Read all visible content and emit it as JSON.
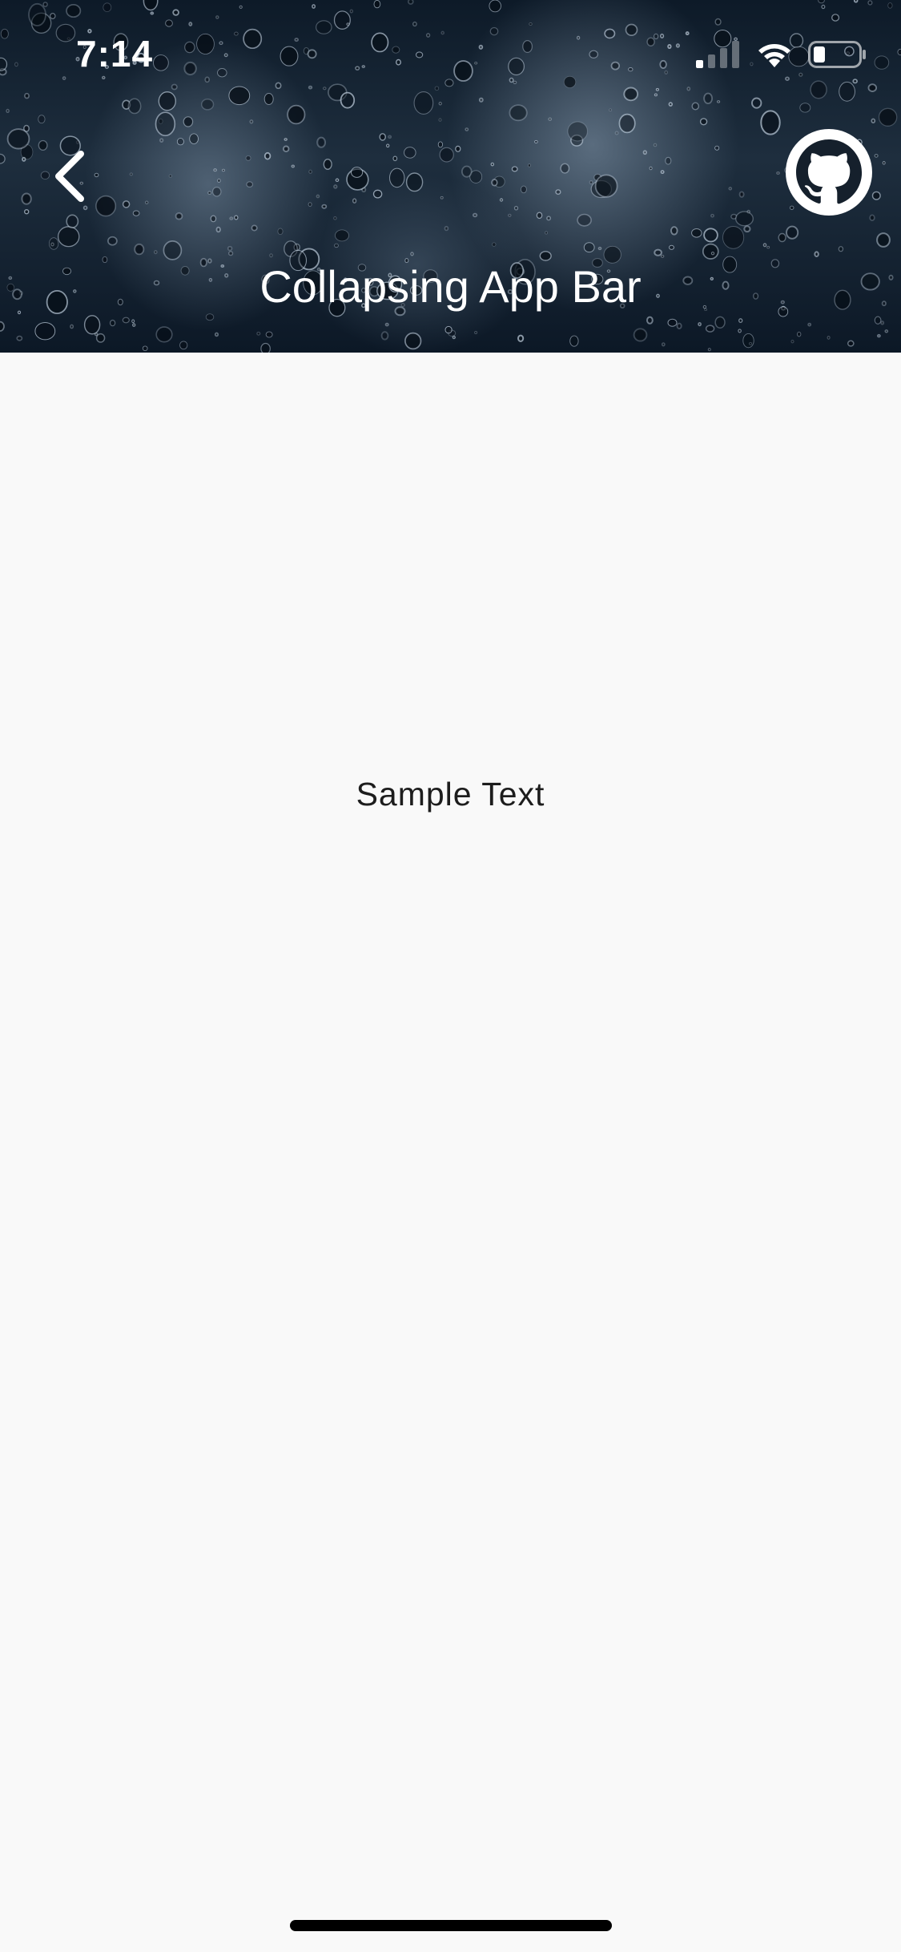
{
  "status_bar": {
    "time": "7:14",
    "icons": [
      "cellular-signal-icon",
      "wifi-icon",
      "battery-icon"
    ]
  },
  "app_bar": {
    "title": "Collapsing App Bar",
    "back_icon": "chevron-left-icon",
    "action_icon": "github-icon",
    "background": "rain-drops-on-glass"
  },
  "content": {
    "text": "Sample Text"
  },
  "colors": {
    "app_bar_dark": "#0d1a28",
    "foreground_on_bar": "#ffffff",
    "page_background": "#f9f9f9",
    "body_text": "#1d1d1d"
  }
}
